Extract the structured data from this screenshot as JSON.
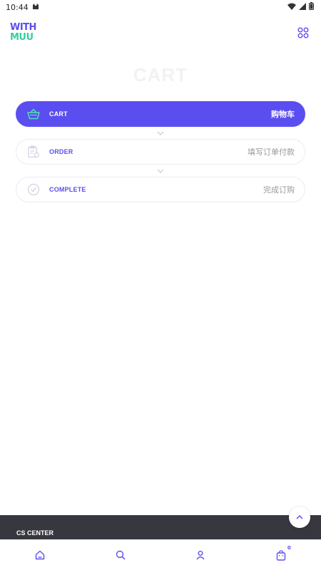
{
  "status_bar": {
    "time": "10:44"
  },
  "header": {
    "logo_line1": "WITH",
    "logo_line2": "MUU"
  },
  "page": {
    "title": "CART"
  },
  "steps": [
    {
      "label": "CART",
      "label_cn": "购物车",
      "icon": "basket-icon",
      "active": true
    },
    {
      "label": "ORDER",
      "label_cn": "填写订单付款",
      "icon": "clipboard-icon",
      "active": false
    },
    {
      "label": "COMPLETE",
      "label_cn": "完成订购",
      "icon": "check-circle-icon",
      "active": false
    }
  ],
  "footer": {
    "title": "CS CENTER"
  },
  "bottom_nav": {
    "cart_count": "0"
  },
  "colors": {
    "accent": "#5b4ef0",
    "logo_green": "#32d0a0",
    "footer_bg": "#37373f"
  }
}
